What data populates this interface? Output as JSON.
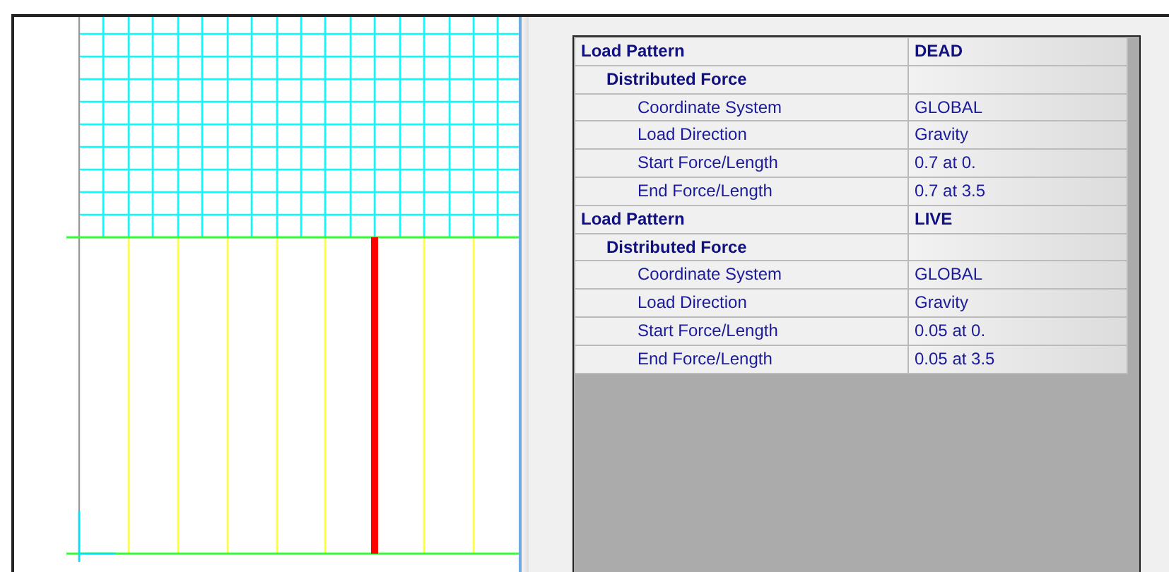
{
  "assignments_table": {
    "rows": [
      {
        "kind": "pattern",
        "label": "Load Pattern",
        "value": "DEAD"
      },
      {
        "kind": "load",
        "label": "Distributed Force"
      },
      {
        "kind": "property",
        "label": "Coordinate System",
        "value": "GLOBAL"
      },
      {
        "kind": "property",
        "label": "Load Direction",
        "value": "Gravity"
      },
      {
        "kind": "property",
        "label": "Start Force/Length",
        "value": "0.7 at 0."
      },
      {
        "kind": "property",
        "label": "End Force/Length",
        "value": "0.7 at 3.5"
      },
      {
        "kind": "pattern",
        "label": "Load Pattern",
        "value": "LIVE"
      },
      {
        "kind": "load",
        "label": "Distributed Force"
      },
      {
        "kind": "property",
        "label": "Coordinate System",
        "value": "GLOBAL"
      },
      {
        "kind": "property",
        "label": "Load Direction",
        "value": "Gravity"
      },
      {
        "kind": "property",
        "label": "Start Force/Length",
        "value": "0.05 at 0."
      },
      {
        "kind": "property",
        "label": "End Force/Length",
        "value": "0.05 at 3.5"
      }
    ]
  }
}
